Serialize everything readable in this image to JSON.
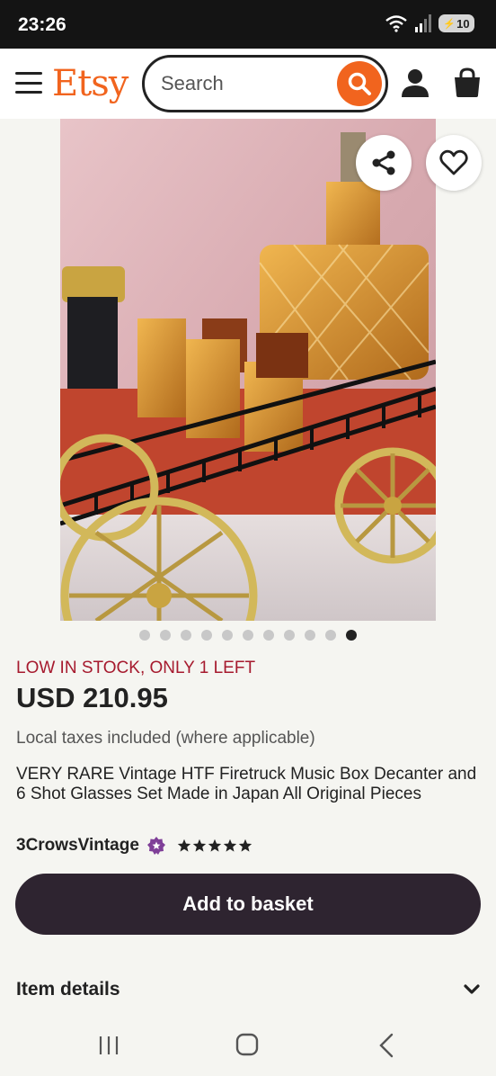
{
  "status_bar": {
    "time": "23:26",
    "battery": "10"
  },
  "header": {
    "logo": "Etsy",
    "search_placeholder": "Search"
  },
  "gallery": {
    "total_images": 11,
    "active_index": 10
  },
  "product": {
    "stock_notice": "LOW IN STOCK, ONLY 1 LEFT",
    "price": "USD 210.95",
    "taxes_note": "Local taxes included (where applicable)",
    "title": "VERY RARE Vintage HTF Firetruck Music Box Decanter and 6 Shot Glasses Set Made in Japan All Original Pieces",
    "shop_name": "3CrowsVintage",
    "rating": 5
  },
  "actions": {
    "add_to_basket": "Add to basket"
  },
  "sections": {
    "item_details": "Item details"
  },
  "colors": {
    "brand": "#f1641e",
    "primary_button": "#2e2430",
    "stock_warning": "#a61a2e",
    "star_seller": "#7f3f98"
  }
}
